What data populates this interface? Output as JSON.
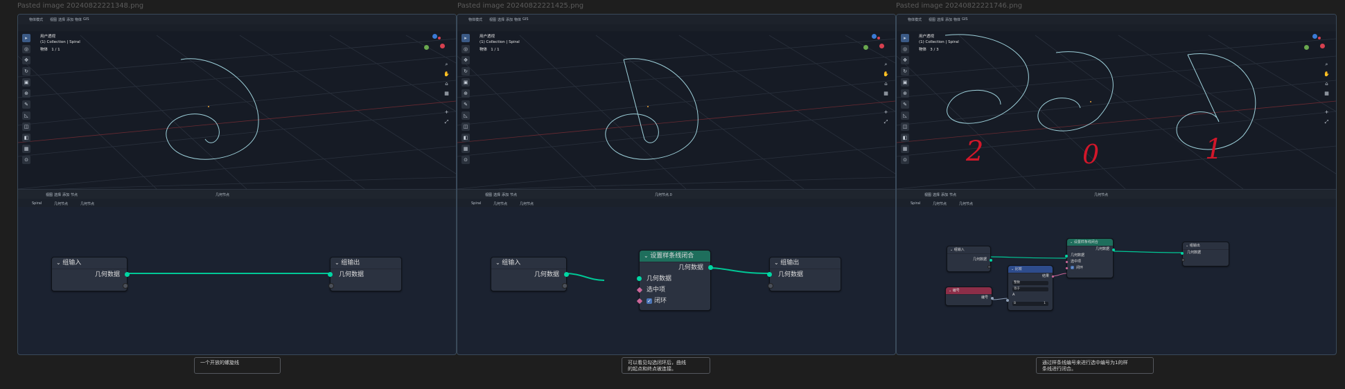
{
  "panels": [
    {
      "id": "p1",
      "filename": "Pasted image 20240822221348.png",
      "mode": "物体模式",
      "viewport_title": "用户透视",
      "collection": "(1) Collection | Spiral",
      "object_count_label": "物体",
      "object_count": "1 / 1",
      "breadcrumb": [
        "Spiral",
        "几何节点",
        "几何节点"
      ],
      "tree_name": "几何节点",
      "caption": "一个开放的螺旋线",
      "nodes": {
        "group_input": "组输入",
        "group_output": "组输出",
        "geometry": "几何数据"
      }
    },
    {
      "id": "p2",
      "filename": "Pasted image 20240822221425.png",
      "mode": "物体模式",
      "viewport_title": "用户透视",
      "collection": "(1) Collection | Spiral",
      "object_count_label": "物体",
      "object_count": "1 / 1",
      "breadcrumb": [
        "Spiral",
        "几何节点",
        "几何节点"
      ],
      "tree_name": "几何节点.0",
      "caption_lines": [
        "可以看见勾选闭环后，曲线",
        "的起点和终点被连接。"
      ],
      "nodes": {
        "group_input": "组输入",
        "group_output": "组输出",
        "set_cyclic": "设置样条线闭合",
        "geometry": "几何数据",
        "selection": "选中项",
        "cyclic": "闭环"
      }
    },
    {
      "id": "p3",
      "filename": "Pasted image 20240822221746.png",
      "mode": "物体模式",
      "viewport_title": "用户透视",
      "collection": "(1) Collection | Spiral",
      "object_count_label": "物体",
      "object_count": "3 / 3",
      "breadcrumb": [
        "Spiral",
        "几何节点",
        "几何节点"
      ],
      "tree_name": "几何节点",
      "caption_lines": [
        "通过样条线编号来进行选中编号为1的样",
        "条线进行闭合。"
      ],
      "handwritten": [
        "2",
        "0",
        "1"
      ],
      "nodes": {
        "group_input": "组输入",
        "group_output": "组输出",
        "set_cyclic": "设置样条线闭合",
        "compare": "比较",
        "index": "编号",
        "geometry": "几何数据",
        "selection": "选中项",
        "cyclic": "闭环",
        "compare_type": "整数",
        "compare_op": "等于",
        "a": "A",
        "b": "B",
        "b_value": "1",
        "result": "结果"
      }
    }
  ],
  "menus": [
    "视图",
    "选择",
    "添加",
    "物体",
    "GIS"
  ],
  "node_menus": [
    "视图",
    "选择",
    "添加",
    "节点"
  ],
  "colors": {
    "background": "#1e1e1e",
    "viewport": "#161b25",
    "node_editor": "#1b2230",
    "geometry_socket": "#00d6a3",
    "curve": "#9fd2dc",
    "set_cyclic_header": "#1e6e5c",
    "compare_header": "#2e4c8c",
    "index_header": "#8c2e48",
    "handwriting": "#d1172a"
  }
}
